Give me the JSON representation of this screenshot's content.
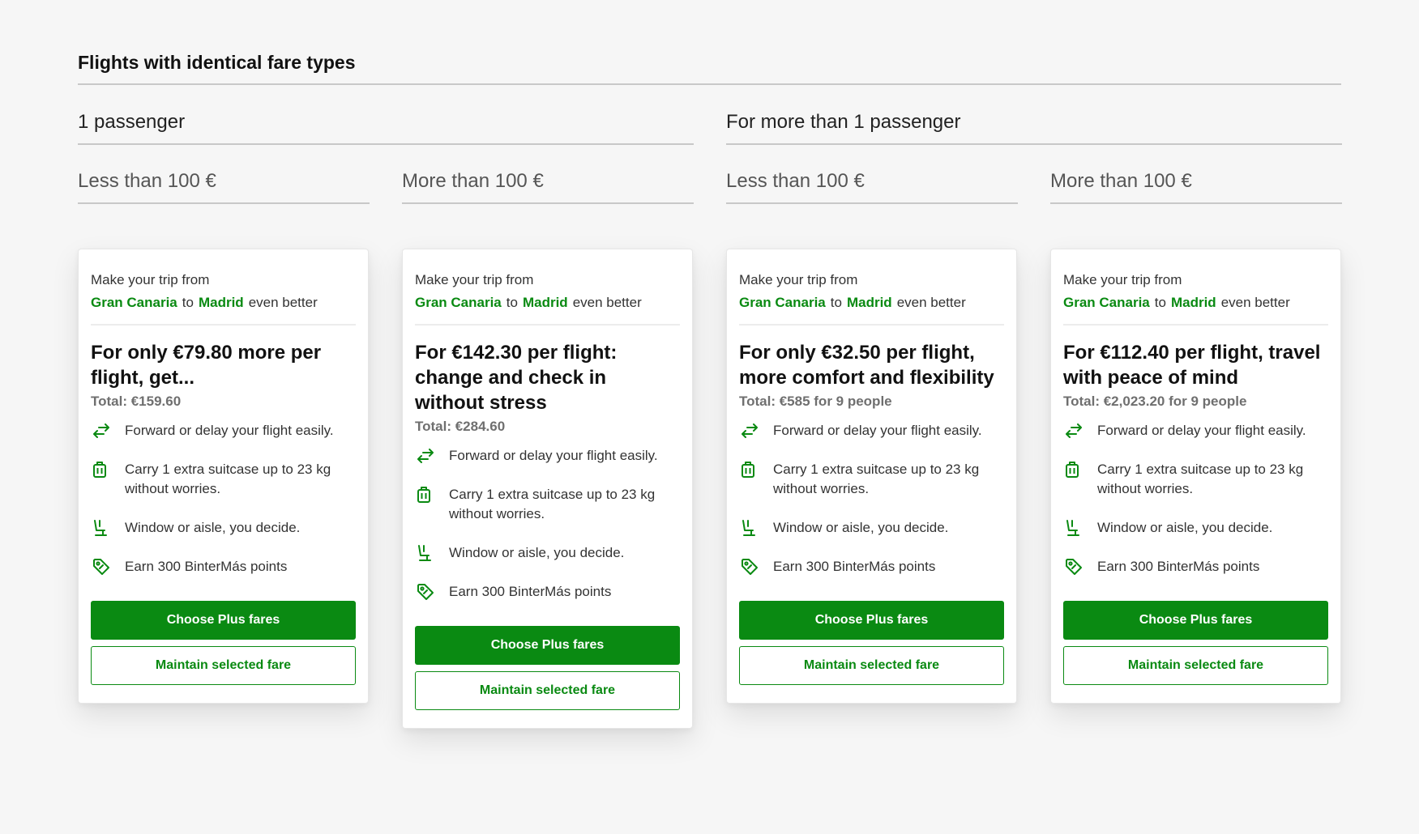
{
  "page_title": "Flights with identical fare types",
  "groups": [
    {
      "label": "1 passenger"
    },
    {
      "label": "For more than 1 passenger"
    }
  ],
  "subgroups": [
    {
      "label": "Less than 100 €"
    },
    {
      "label": "More than 100 €"
    },
    {
      "label": "Less than 100 €"
    },
    {
      "label": "More than 100 €"
    }
  ],
  "colors": {
    "accent": "#0a8a12"
  },
  "icons": [
    "swap-arrows-icon",
    "suitcase-icon",
    "seat-icon",
    "tag-icon"
  ],
  "cards": [
    {
      "intro": "Make your trip from",
      "from": "Gran Canaria",
      "to_word": "to",
      "to": "Madrid",
      "suffix": "even better",
      "headline": "For only €79.80 more per flight, get...",
      "total": "Total: €159.60",
      "features": [
        "Forward or delay your flight easily.",
        "Carry 1 extra suitcase up to 23 kg without worries.",
        "Window or aisle, you decide.",
        "Earn 300 BinterMás points"
      ],
      "primary_label": "Choose Plus fares",
      "secondary_label": "Maintain selected fare"
    },
    {
      "intro": "Make your trip from",
      "from": "Gran Canaria",
      "to_word": "to",
      "to": "Madrid",
      "suffix": "even better",
      "headline": "For €142.30 per flight: change and check in without stress",
      "total": "Total: €284.60",
      "features": [
        "Forward or delay your flight easily.",
        "Carry 1 extra suitcase up to 23 kg without worries.",
        "Window or aisle, you decide.",
        "Earn 300 BinterMás points"
      ],
      "primary_label": "Choose Plus fares",
      "secondary_label": "Maintain selected fare"
    },
    {
      "intro": "Make your trip from",
      "from": "Gran Canaria",
      "to_word": "to",
      "to": "Madrid",
      "suffix": "even better",
      "headline": "For only €32.50 per flight, more comfort and flexibility",
      "total": "Total: €585 for 9 people",
      "features": [
        "Forward or delay your flight easily.",
        "Carry 1 extra suitcase up to 23 kg without worries.",
        "Window or aisle, you decide.",
        "Earn 300 BinterMás points"
      ],
      "primary_label": "Choose Plus fares",
      "secondary_label": "Maintain selected fare"
    },
    {
      "intro": "Make your trip from",
      "from": "Gran Canaria",
      "to_word": "to",
      "to": "Madrid",
      "suffix": "even better",
      "headline": "For €112.40 per flight, travel with peace of mind",
      "total": "Total: €2,023.20 for 9 people",
      "features": [
        "Forward or delay your flight easily.",
        "Carry 1 extra suitcase up to 23 kg without worries.",
        "Window or aisle, you decide.",
        "Earn 300 BinterMás points"
      ],
      "primary_label": "Choose Plus fares",
      "secondary_label": "Maintain selected fare"
    }
  ]
}
